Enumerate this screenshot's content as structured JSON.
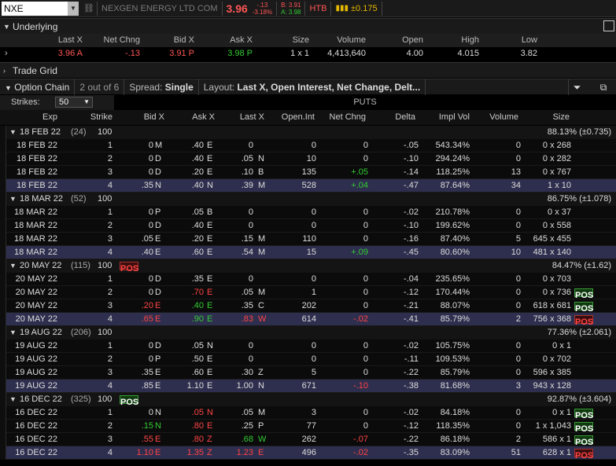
{
  "header": {
    "symbol": "NXE",
    "company": "NEXGEN ENERGY LTD COM",
    "last": "3.96",
    "chg": "-.13",
    "chg_pct": "-3.18%",
    "bid": "B: 3.91",
    "ask": "A: 3.98",
    "htb": "HTB",
    "move": "±0.175"
  },
  "underlying": {
    "title": "Underlying",
    "cols": [
      "Last X",
      "Net Chng",
      "Bid X",
      "Ask X",
      "Size",
      "Volume",
      "Open",
      "High",
      "Low"
    ],
    "vals": [
      "3.96 A",
      "-.13",
      "3.91 P",
      "3.98 P",
      "1 x 1",
      "4,413,640",
      "4.00",
      "4.015",
      "3.82"
    ]
  },
  "trade_grid": {
    "title": "Trade Grid"
  },
  "option_chain": {
    "title": "Option Chain",
    "count": "2 out of 6",
    "spread_label": "Spread:",
    "spread": "Single",
    "layout_label": "Layout:",
    "layout": "Last X, Open Interest, Net Change, Delt..."
  },
  "controls": {
    "strikes_label": "Strikes:",
    "strikes": "50",
    "puts_label": "PUTS"
  },
  "columns": [
    "Exp",
    "Strike",
    "Bid X",
    "Ask X",
    "Last X",
    "Open.Int",
    "Net Chng",
    "Delta",
    "Impl Vol",
    "Volume",
    "Size"
  ],
  "pos_label": "POS",
  "groups": [
    {
      "exp": "18 FEB 22",
      "days": "(24)",
      "mult": "100",
      "pos": "",
      "iv": "88.13% (±0.735)",
      "rows": [
        {
          "e": "18 FEB 22",
          "s": "1",
          "b": "0",
          "bx": "M",
          "a": ".40",
          "ax": "E",
          "l": "0",
          "lx": "",
          "oi": "0",
          "nc": "0",
          "d": "-.05",
          "iv": "543.34%",
          "v": "0",
          "sz": "0 x 268",
          "p": "",
          "itm": false,
          "bc": "white",
          "ac": "white",
          "lc": "white",
          "ncc": "white"
        },
        {
          "e": "18 FEB 22",
          "s": "2",
          "b": "0",
          "bx": "D",
          "a": ".40",
          "ax": "E",
          "l": ".05",
          "lx": "N",
          "oi": "10",
          "nc": "0",
          "d": "-.10",
          "iv": "294.24%",
          "v": "0",
          "sz": "0 x 282",
          "p": "",
          "itm": false,
          "bc": "white",
          "ac": "white",
          "lc": "white",
          "ncc": "white"
        },
        {
          "e": "18 FEB 22",
          "s": "3",
          "b": "0",
          "bx": "D",
          "a": ".20",
          "ax": "E",
          "l": ".10",
          "lx": "B",
          "oi": "135",
          "nc": "+.05",
          "d": "-.14",
          "iv": "118.25%",
          "v": "13",
          "sz": "0 x 767",
          "p": "",
          "itm": false,
          "bc": "white",
          "ac": "white",
          "lc": "white",
          "ncc": "green"
        },
        {
          "e": "18 FEB 22",
          "s": "4",
          "b": ".35",
          "bx": "N",
          "a": ".40",
          "ax": "N",
          "l": ".39",
          "lx": "M",
          "oi": "528",
          "nc": "+.04",
          "d": "-.47",
          "iv": "87.64%",
          "v": "34",
          "sz": "1 x 10",
          "p": "",
          "itm": true,
          "bc": "white",
          "ac": "white",
          "lc": "white",
          "ncc": "green"
        }
      ]
    },
    {
      "exp": "18 MAR 22",
      "days": "(52)",
      "mult": "100",
      "pos": "",
      "iv": "86.75% (±1.078)",
      "rows": [
        {
          "e": "18 MAR 22",
          "s": "1",
          "b": "0",
          "bx": "P",
          "a": ".05",
          "ax": "B",
          "l": "0",
          "lx": "",
          "oi": "0",
          "nc": "0",
          "d": "-.02",
          "iv": "210.78%",
          "v": "0",
          "sz": "0 x 37",
          "p": "",
          "itm": false,
          "bc": "white",
          "ac": "white",
          "lc": "white",
          "ncc": "white"
        },
        {
          "e": "18 MAR 22",
          "s": "2",
          "b": "0",
          "bx": "D",
          "a": ".40",
          "ax": "E",
          "l": "0",
          "lx": "",
          "oi": "0",
          "nc": "0",
          "d": "-.10",
          "iv": "199.62%",
          "v": "0",
          "sz": "0 x 558",
          "p": "",
          "itm": false,
          "bc": "white",
          "ac": "white",
          "lc": "white",
          "ncc": "white"
        },
        {
          "e": "18 MAR 22",
          "s": "3",
          "b": ".05",
          "bx": "E",
          "a": ".20",
          "ax": "E",
          "l": ".15",
          "lx": "M",
          "oi": "110",
          "nc": "0",
          "d": "-.16",
          "iv": "87.40%",
          "v": "5",
          "sz": "645 x 455",
          "p": "",
          "itm": false,
          "bc": "white",
          "ac": "white",
          "lc": "white",
          "ncc": "white"
        },
        {
          "e": "18 MAR 22",
          "s": "4",
          "b": ".40",
          "bx": "E",
          "a": ".60",
          "ax": "E",
          "l": ".54",
          "lx": "M",
          "oi": "15",
          "nc": "+.09",
          "d": "-.45",
          "iv": "80.60%",
          "v": "10",
          "sz": "481 x 140",
          "p": "",
          "itm": true,
          "bc": "white",
          "ac": "white",
          "lc": "white",
          "ncc": "green"
        }
      ]
    },
    {
      "exp": "20 MAY 22",
      "days": "(115)",
      "mult": "100",
      "pos": "red",
      "iv": "84.47% (±1.62)",
      "rows": [
        {
          "e": "20 MAY 22",
          "s": "1",
          "b": "0",
          "bx": "D",
          "a": ".35",
          "ax": "E",
          "l": "0",
          "lx": "",
          "oi": "0",
          "nc": "0",
          "d": "-.04",
          "iv": "235.65%",
          "v": "0",
          "sz": "0 x 703",
          "p": "",
          "itm": false,
          "bc": "white",
          "ac": "white",
          "lc": "white",
          "ncc": "white"
        },
        {
          "e": "20 MAY 22",
          "s": "2",
          "b": "0",
          "bx": "D",
          "a": ".70",
          "ax": "E",
          "l": ".05",
          "lx": "M",
          "oi": "1",
          "nc": "0",
          "d": "-.12",
          "iv": "170.44%",
          "v": "0",
          "sz": "0 x 736",
          "p": "green",
          "itm": false,
          "bc": "white",
          "ac": "red",
          "lc": "white",
          "ncc": "white"
        },
        {
          "e": "20 MAY 22",
          "s": "3",
          "b": ".20",
          "bx": "E",
          "a": ".40",
          "ax": "E",
          "l": ".35",
          "lx": "C",
          "oi": "202",
          "nc": "0",
          "d": "-.21",
          "iv": "88.07%",
          "v": "0",
          "sz": "618 x 681",
          "p": "green",
          "itm": false,
          "bc": "red",
          "ac": "green",
          "lc": "white",
          "ncc": "white"
        },
        {
          "e": "20 MAY 22",
          "s": "4",
          "b": ".65",
          "bx": "E",
          "a": ".90",
          "ax": "E",
          "l": ".83",
          "lx": "W",
          "oi": "614",
          "nc": "-.02",
          "d": "-.41",
          "iv": "85.79%",
          "v": "2",
          "sz": "756 x 368",
          "p": "red",
          "itm": true,
          "bc": "red",
          "ac": "green",
          "lc": "red",
          "ncc": "red"
        }
      ]
    },
    {
      "exp": "19 AUG 22",
      "days": "(206)",
      "mult": "100",
      "pos": "",
      "iv": "77.36% (±2.061)",
      "rows": [
        {
          "e": "19 AUG 22",
          "s": "1",
          "b": "0",
          "bx": "D",
          "a": ".05",
          "ax": "N",
          "l": "0",
          "lx": "",
          "oi": "0",
          "nc": "0",
          "d": "-.02",
          "iv": "105.75%",
          "v": "0",
          "sz": "0 x 1",
          "p": "",
          "itm": false,
          "bc": "white",
          "ac": "white",
          "lc": "white",
          "ncc": "white"
        },
        {
          "e": "19 AUG 22",
          "s": "2",
          "b": "0",
          "bx": "P",
          "a": ".50",
          "ax": "E",
          "l": "0",
          "lx": "",
          "oi": "0",
          "nc": "0",
          "d": "-.11",
          "iv": "109.53%",
          "v": "0",
          "sz": "0 x 702",
          "p": "",
          "itm": false,
          "bc": "white",
          "ac": "white",
          "lc": "white",
          "ncc": "white"
        },
        {
          "e": "19 AUG 22",
          "s": "3",
          "b": ".35",
          "bx": "E",
          "a": ".60",
          "ax": "E",
          "l": ".30",
          "lx": "Z",
          "oi": "5",
          "nc": "0",
          "d": "-.22",
          "iv": "85.79%",
          "v": "0",
          "sz": "596 x 385",
          "p": "",
          "itm": false,
          "bc": "white",
          "ac": "white",
          "lc": "white",
          "ncc": "white"
        },
        {
          "e": "19 AUG 22",
          "s": "4",
          "b": ".85",
          "bx": "E",
          "a": "1.10",
          "ax": "E",
          "l": "1.00",
          "lx": "N",
          "oi": "671",
          "nc": "-.10",
          "d": "-.38",
          "iv": "81.68%",
          "v": "3",
          "sz": "943 x 128",
          "p": "",
          "itm": true,
          "bc": "white",
          "ac": "white",
          "lc": "white",
          "ncc": "red"
        }
      ]
    },
    {
      "exp": "16 DEC 22",
      "days": "(325)",
      "mult": "100",
      "pos": "green",
      "iv": "92.87% (±3.604)",
      "rows": [
        {
          "e": "16 DEC 22",
          "s": "1",
          "b": "0",
          "bx": "N",
          "a": ".05",
          "ax": "N",
          "l": ".05",
          "lx": "M",
          "oi": "3",
          "nc": "0",
          "d": "-.02",
          "iv": "84.18%",
          "v": "0",
          "sz": "0 x 1",
          "p": "green",
          "itm": false,
          "bc": "white",
          "ac": "red",
          "lc": "white",
          "ncc": "white"
        },
        {
          "e": "16 DEC 22",
          "s": "2",
          "b": ".15",
          "bx": "N",
          "a": ".80",
          "ax": "E",
          "l": ".25",
          "lx": "P",
          "oi": "77",
          "nc": "0",
          "d": "-.12",
          "iv": "118.35%",
          "v": "0",
          "sz": "1 x 1,043",
          "p": "green",
          "itm": false,
          "bc": "green",
          "ac": "red",
          "lc": "white",
          "ncc": "white"
        },
        {
          "e": "16 DEC 22",
          "s": "3",
          "b": ".55",
          "bx": "E",
          "a": ".80",
          "ax": "Z",
          "l": ".68",
          "lx": "W",
          "oi": "262",
          "nc": "-.07",
          "d": "-.22",
          "iv": "86.18%",
          "v": "2",
          "sz": "586 x 1",
          "p": "green",
          "itm": false,
          "bc": "red",
          "ac": "red",
          "lc": "green",
          "ncc": "red"
        },
        {
          "e": "16 DEC 22",
          "s": "4",
          "b": "1.10",
          "bx": "E",
          "a": "1.35",
          "ax": "Z",
          "l": "1.23",
          "lx": "E",
          "oi": "496",
          "nc": "-.02",
          "d": "-.35",
          "iv": "83.09%",
          "v": "51",
          "sz": "628 x 1",
          "p": "red",
          "itm": true,
          "bc": "red",
          "ac": "red",
          "lc": "red",
          "ncc": "red"
        }
      ]
    }
  ]
}
